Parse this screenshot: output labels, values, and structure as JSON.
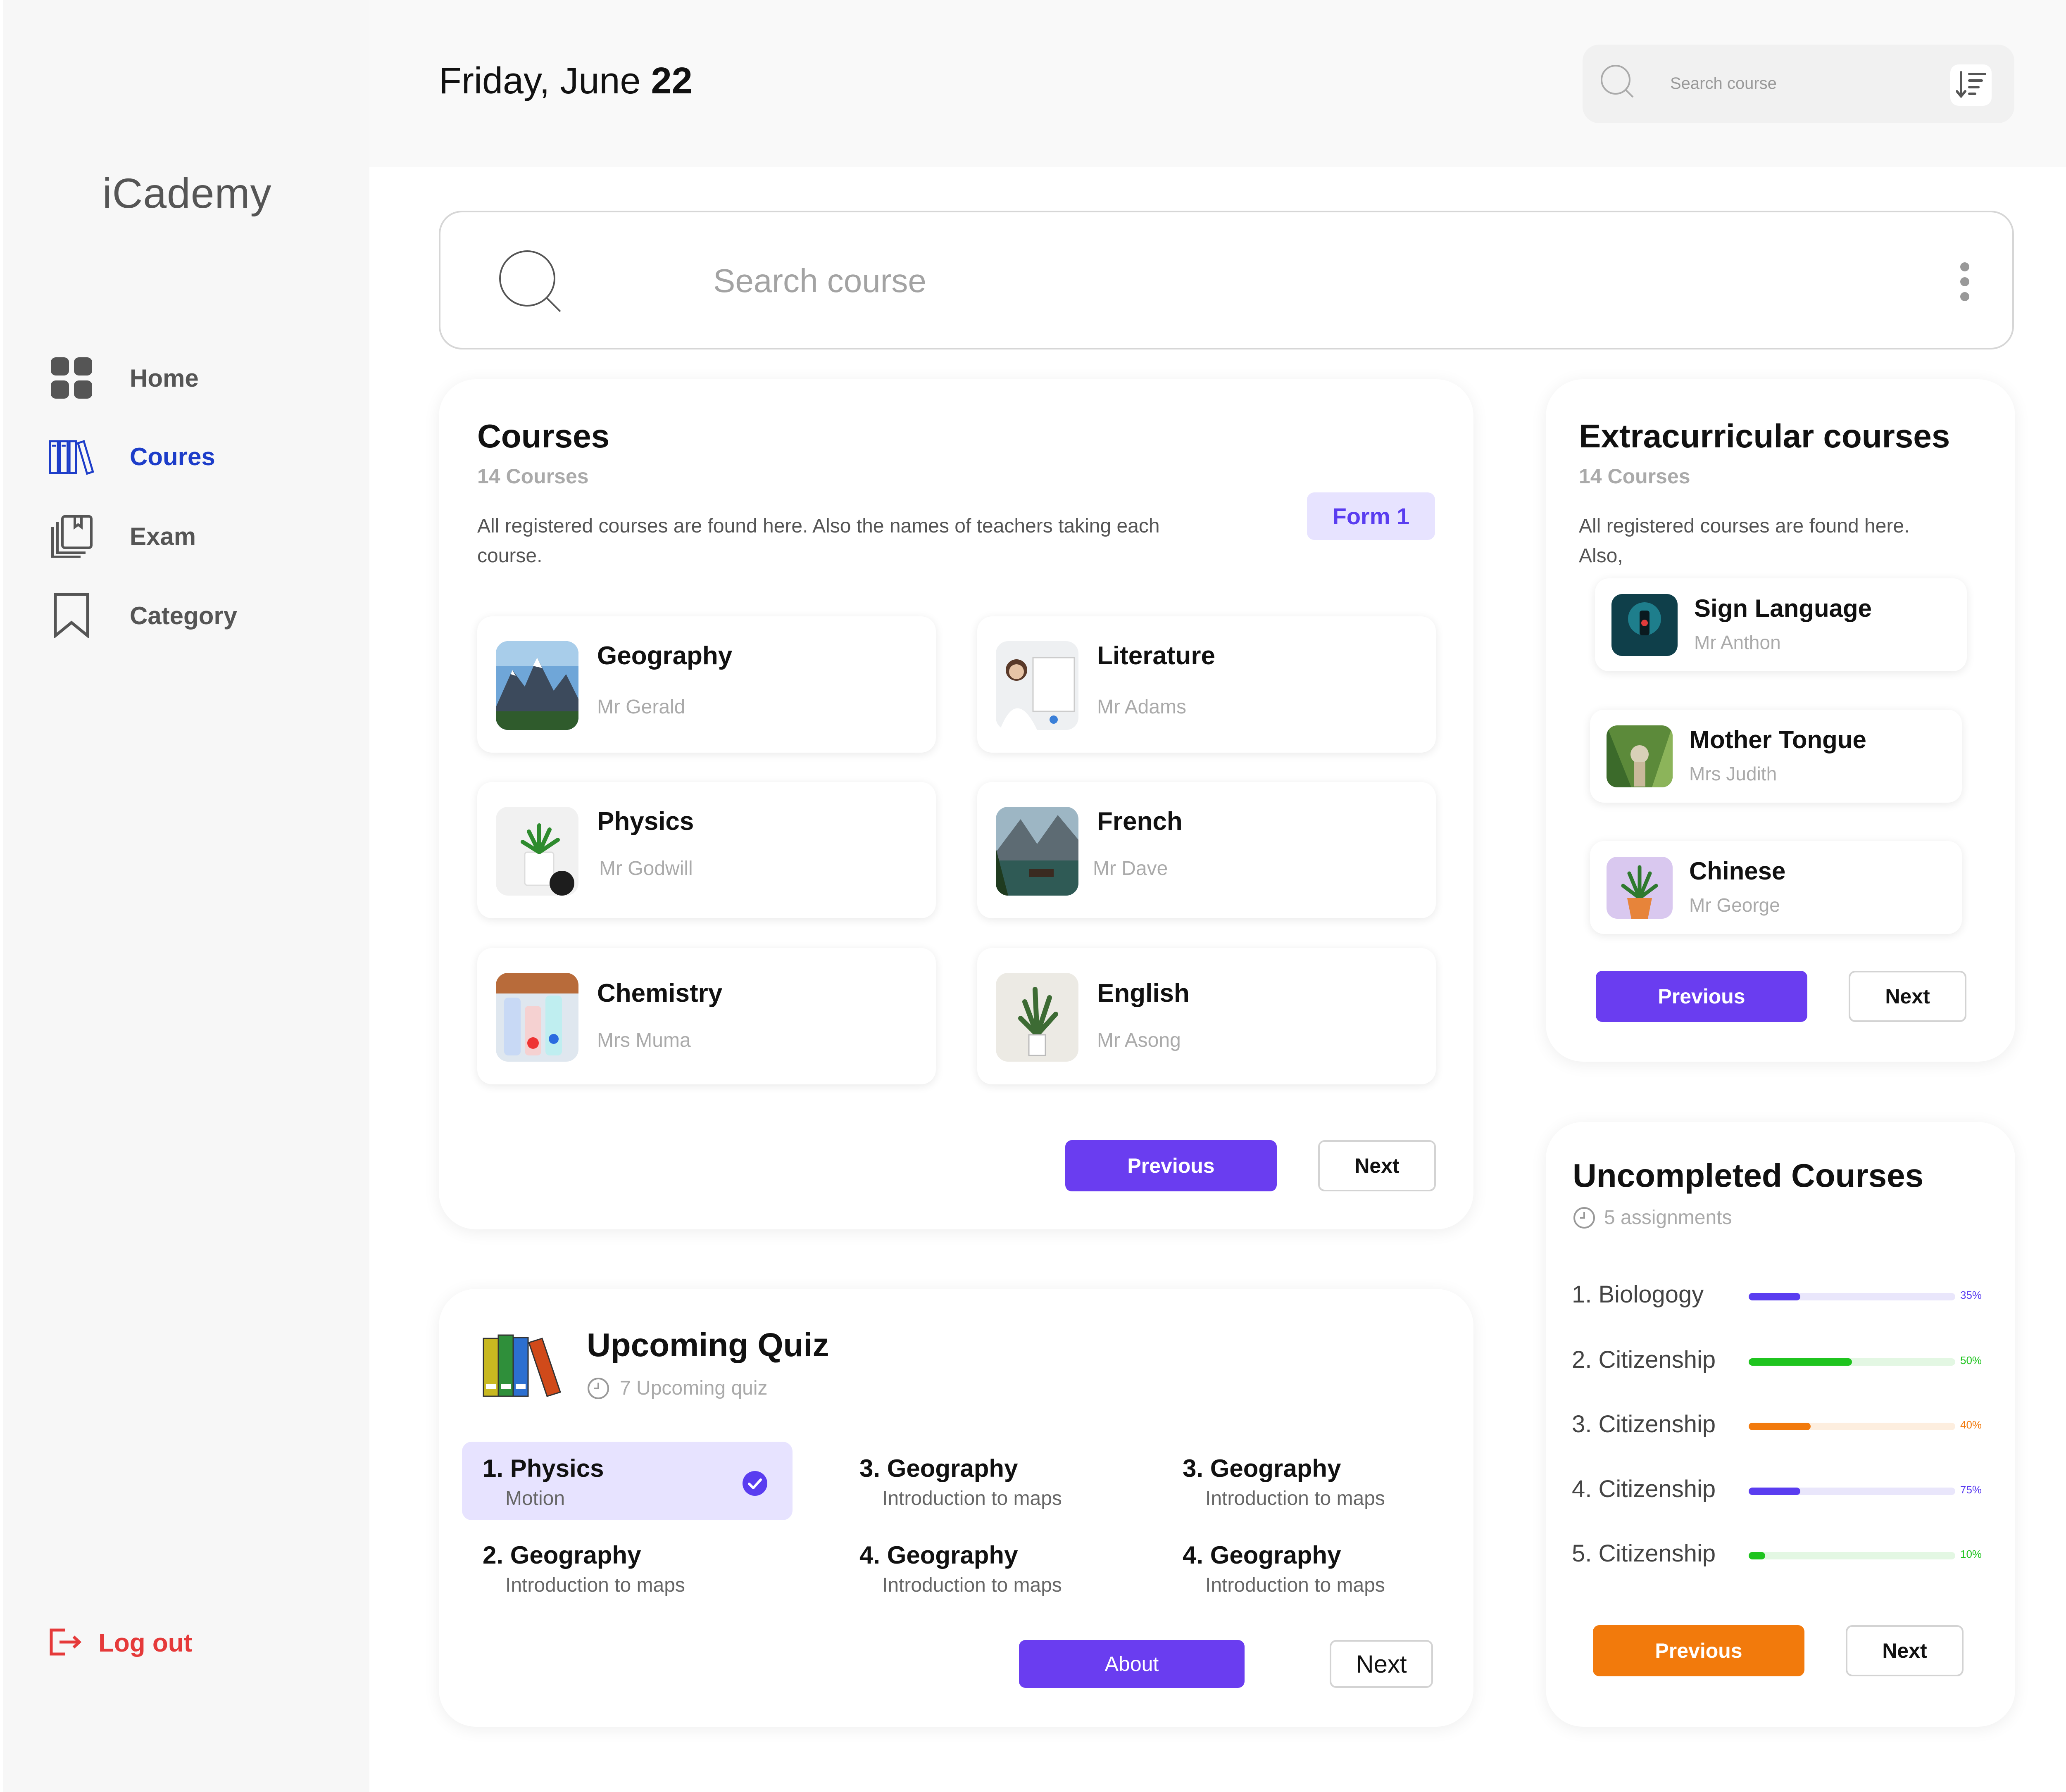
{
  "app": {
    "name": "iCademy"
  },
  "sidebar": {
    "items": [
      {
        "label": "Home",
        "icon": "grid-icon",
        "active": false
      },
      {
        "label": "Coures",
        "icon": "books-icon",
        "active": true
      },
      {
        "label": "Exam",
        "icon": "exam-icon",
        "active": false
      },
      {
        "label": "Category",
        "icon": "bookmark-icon",
        "active": false
      }
    ],
    "logout": "Log out"
  },
  "header": {
    "date_prefix": "Friday, June ",
    "date_day": "22",
    "search_placeholder": "Search course"
  },
  "main_search": {
    "placeholder": "Search course"
  },
  "courses": {
    "title": "Courses",
    "count": "14 Courses",
    "description": "All registered courses are found here. Also the names of teachers taking each course.",
    "badge": "Form 1",
    "items": [
      {
        "name": "Geography",
        "teacher": "Mr Gerald"
      },
      {
        "name": "Literature",
        "teacher": "Mr Adams"
      },
      {
        "name": "Physics",
        "teacher": "Mr Godwill"
      },
      {
        "name": "French",
        "teacher": "Mr Dave"
      },
      {
        "name": "Chemistry",
        "teacher": "Mrs Muma"
      },
      {
        "name": "English",
        "teacher": "Mr Asong"
      }
    ],
    "prev_label": "Previous",
    "next_label": "Next"
  },
  "extracurricular": {
    "title": "Extracurricular courses",
    "count": "14 Courses",
    "description": "All registered courses are found here. Also,",
    "items": [
      {
        "name": "Sign Language",
        "teacher": "Mr Anthon"
      },
      {
        "name": "Mother Tongue",
        "teacher": "Mrs Judith"
      },
      {
        "name": "Chinese",
        "teacher": "Mr George"
      }
    ],
    "prev_label": "Previous",
    "next_label": "Next"
  },
  "quiz": {
    "title": "Upcoming Quiz",
    "subtitle": "7 Upcoming quiz",
    "items": [
      {
        "title": "1. Physics",
        "topic": "Motion",
        "selected": true
      },
      {
        "title": "2. Geography",
        "topic": "Introduction to maps",
        "selected": false
      },
      {
        "title": "3. Geography",
        "topic": "Introduction to maps",
        "selected": false
      },
      {
        "title": "4. Geography",
        "topic": "Introduction to maps",
        "selected": false
      },
      {
        "title": "3. Geography",
        "topic": "Introduction to maps",
        "selected": false
      },
      {
        "title": "4. Geography",
        "topic": "Introduction to maps",
        "selected": false
      }
    ],
    "about_label": "About",
    "next_label": "Next"
  },
  "uncompleted": {
    "title": "Uncompleted Courses",
    "subtitle": "5 assignments",
    "items": [
      {
        "label": "1. Biologogy",
        "progress": 0.25,
        "pct_label": "35%",
        "color": "#5a3df0",
        "track": "#e9e6fb"
      },
      {
        "label": "2. Citizenship",
        "progress": 0.5,
        "pct_label": "50%",
        "color": "#1fc41f",
        "track": "#e3f7e3"
      },
      {
        "label": "3. Citizenship",
        "progress": 0.3,
        "pct_label": "40%",
        "color": "#f27a0c",
        "track": "#fdeedf"
      },
      {
        "label": "4. Citizenship",
        "progress": 0.25,
        "pct_label": "75%",
        "color": "#5a3df0",
        "track": "#e9e6fb"
      },
      {
        "label": "5. Citizenship",
        "progress": 0.08,
        "pct_label": "10%",
        "color": "#1fc41f",
        "track": "#e3f7e3"
      }
    ],
    "prev_label": "Previous",
    "next_label": "Next"
  },
  "colors": {
    "accent": "#6a3df0",
    "active_nav": "#1d3dc9",
    "logout": "#e53a3a",
    "orange": "#f27a0c"
  }
}
